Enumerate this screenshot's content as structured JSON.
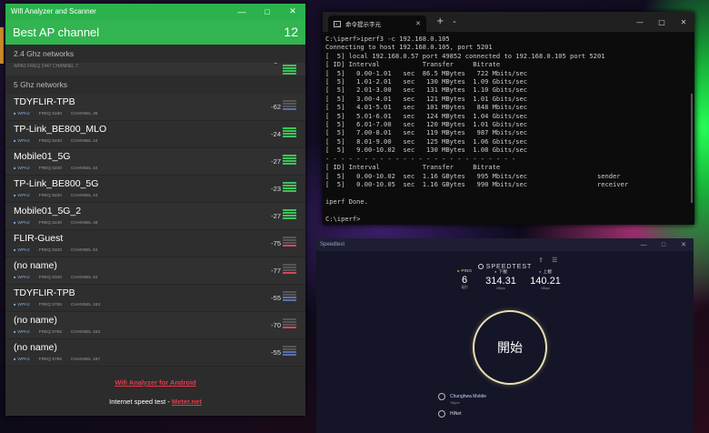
{
  "wifi": {
    "title": "Wifi Analyzer and Scanner",
    "best_label": "Best AP channel",
    "best_value": "12",
    "band_24_label": "2.4 Ghz networks",
    "band_24_row": {
      "meta": "WPA2     FREQ 2447     CHANNEL 7",
      "level": "-5",
      "bars": 4,
      "color": "#3cc35a"
    },
    "band_5_label": "5 Ghz networks",
    "networks": [
      {
        "ssid": "TDYFLIR-TPB",
        "security": "WPA2",
        "freq": "FREQ 5180",
        "channel": "CHANNEL 36",
        "level": "-62",
        "bars": 1,
        "color": "#5a6fb0"
      },
      {
        "ssid": "TP-Link_BE800_MLO",
        "security": "WPA2",
        "freq": "FREQ 5220",
        "channel": "CHANNEL 44",
        "level": "-24",
        "bars": 4,
        "color": "#3cc35a"
      },
      {
        "ssid": "Mobile01_5G",
        "security": "WPA2",
        "freq": "FREQ 5220",
        "channel": "CHANNEL 44",
        "level": "-27",
        "bars": 4,
        "color": "#3cc35a"
      },
      {
        "ssid": "TP-Link_BE800_5G",
        "security": "WPA2",
        "freq": "FREQ 5220",
        "channel": "CHANNEL 44",
        "level": "-23",
        "bars": 4,
        "color": "#3cc35a"
      },
      {
        "ssid": "Mobile01_5G_2",
        "security": "WPA2",
        "freq": "FREQ 5240",
        "channel": "CHANNEL 48",
        "level": "-27",
        "bars": 4,
        "color": "#3cc35a"
      },
      {
        "ssid": "FLIR-Guest",
        "security": "WPA2",
        "freq": "FREQ 5320",
        "channel": "CHANNEL 64",
        "level": "-75",
        "bars": 1,
        "color": "#d9455a"
      },
      {
        "ssid": "(no name)",
        "security": "WPA2",
        "freq": "FREQ 5320",
        "channel": "CHANNEL 64",
        "level": "-77",
        "bars": 1,
        "color": "#d9455a"
      },
      {
        "ssid": "TDYFLIR-TPB",
        "security": "WPA2",
        "freq": "FREQ 5765",
        "channel": "CHANNEL 153",
        "level": "-55",
        "bars": 2,
        "color": "#5a6fb0"
      },
      {
        "ssid": "(no name)",
        "security": "WPA2",
        "freq": "FREQ 5765",
        "channel": "CHANNEL 153",
        "level": "-70",
        "bars": 1,
        "color": "#d9455a"
      },
      {
        "ssid": "(no name)",
        "security": "WPA2",
        "freq": "FREQ 5785",
        "channel": "CHANNEL 157",
        "level": "-55",
        "bars": 2,
        "color": "#5a6fb0"
      }
    ],
    "footer_link": "Wifi Analyzer for Android",
    "footer_speed_text": "Internet speed test - ",
    "footer_speed_link": "Meter.net",
    "accent_color": "#2bb24c"
  },
  "terminal": {
    "tab_title": "命令提示字元",
    "lines": [
      "C:\\iperf>iperf3 -c 192.168.0.105",
      "Connecting to host 192.168.0.105, port 5201",
      "[  5] local 192.168.0.57 port 49852 connected to 192.168.0.105 port 5201",
      "[ ID] Interval           Transfer     Bitrate",
      "[  5]   0.00-1.01   sec  86.5 MBytes   722 Mbits/sec",
      "[  5]   1.01-2.01   sec   130 MBytes  1.09 Gbits/sec",
      "[  5]   2.01-3.00   sec   131 MBytes  1.10 Gbits/sec",
      "[  5]   3.00-4.01   sec   121 MBytes  1.01 Gbits/sec",
      "[  5]   4.01-5.01   sec   101 MBytes   848 Mbits/sec",
      "[  5]   5.01-6.01   sec   124 MBytes  1.04 Gbits/sec",
      "[  5]   6.01-7.00   sec   120 MBytes  1.01 Gbits/sec",
      "[  5]   7.00-8.01   sec   119 MBytes   987 Mbits/sec",
      "[  5]   8.01-9.00   sec   125 MBytes  1.06 Gbits/sec",
      "[  5]   9.00-10.02  sec   130 MBytes  1.08 Gbits/sec",
      "- - - - - - - - - - - - - - - - - - - - - - - - -",
      "[ ID] Interval           Transfer     Bitrate",
      "[  5]   0.00-10.02  sec  1.16 GBytes   995 Mbits/sec                  sender",
      "[  5]   0.00-10.05  sec  1.16 GBytes   990 Mbits/sec                  receiver",
      "",
      "iperf Done.",
      "",
      "C:\\iperf>"
    ]
  },
  "speedtest": {
    "title": "Speedtest",
    "logo": "SPEEDTEST",
    "ping_label": "PING",
    "ping_value": "6",
    "ping_unit": "毫秒",
    "down_label": "下載",
    "down_value": "314.31",
    "down_unit": "Mbps",
    "up_label": "上載",
    "up_value": "140.21",
    "up_unit": "Mbps",
    "go_label": "開始",
    "isp_name": "Chunghwa Mobile",
    "isp_sub": "Taipei",
    "server_name": "HiNet"
  }
}
